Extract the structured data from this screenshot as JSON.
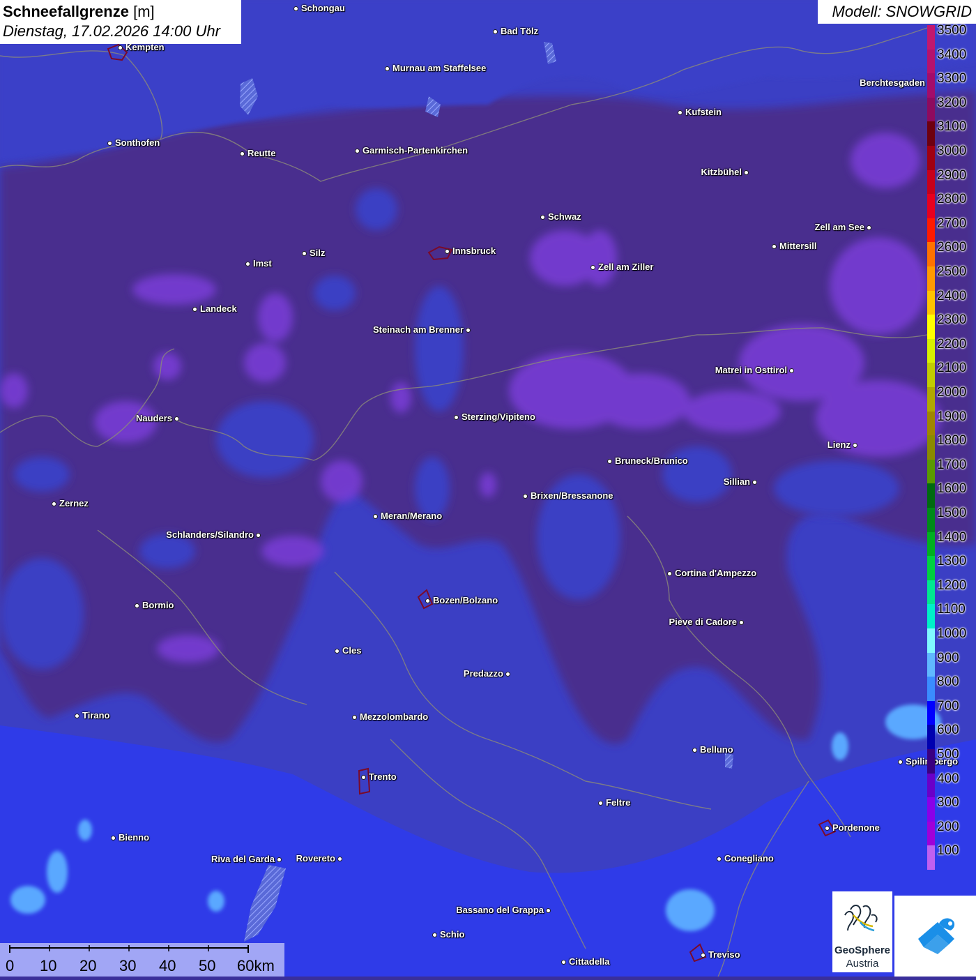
{
  "header": {
    "title_bold": "Schneefallgrenze",
    "title_unit": "[m]",
    "datetime": "Dienstag, 17.02.2026 14:00 Uhr",
    "model": "Modell: SNOWGRID"
  },
  "legend": {
    "levels": [
      {
        "label": "3500",
        "color": "#c2186e"
      },
      {
        "label": "3400",
        "color": "#b5126d"
      },
      {
        "label": "3300",
        "color": "#a30c6a"
      },
      {
        "label": "3200",
        "color": "#8e0a5f"
      },
      {
        "label": "3100",
        "color": "#6e0010"
      },
      {
        "label": "3000",
        "color": "#a00012"
      },
      {
        "label": "2900",
        "color": "#c8001a"
      },
      {
        "label": "2800",
        "color": "#e8001e"
      },
      {
        "label": "2700",
        "color": "#ff1a00"
      },
      {
        "label": "2600",
        "color": "#ff7200"
      },
      {
        "label": "2500",
        "color": "#ff9a00"
      },
      {
        "label": "2400",
        "color": "#ffc400"
      },
      {
        "label": "2300",
        "color": "#ffff00"
      },
      {
        "label": "2200",
        "color": "#d8f000"
      },
      {
        "label": "2100",
        "color": "#c2cc00"
      },
      {
        "label": "2000",
        "color": "#b0a800"
      },
      {
        "label": "1900",
        "color": "#a08600"
      },
      {
        "label": "1800",
        "color": "#8a8a00"
      },
      {
        "label": "1700",
        "color": "#5a9a00"
      },
      {
        "label": "1600",
        "color": "#006a10"
      },
      {
        "label": "1500",
        "color": "#008a18"
      },
      {
        "label": "1400",
        "color": "#00b020"
      },
      {
        "label": "1300",
        "color": "#00d040"
      },
      {
        "label": "1200",
        "color": "#00e890"
      },
      {
        "label": "1100",
        "color": "#00f0c8"
      },
      {
        "label": "1000",
        "color": "#80f8ff"
      },
      {
        "label": "900",
        "color": "#60b8ff"
      },
      {
        "label": "800",
        "color": "#3a8cff"
      },
      {
        "label": "700",
        "color": "#0000ff"
      },
      {
        "label": "600",
        "color": "#0000b0"
      },
      {
        "label": "500",
        "color": "#3a0080"
      },
      {
        "label": "400",
        "color": "#6a00c8"
      },
      {
        "label": "300",
        "color": "#8a00e8"
      },
      {
        "label": "200",
        "color": "#a000d8"
      },
      {
        "label": "100",
        "color": "#c060f0"
      }
    ]
  },
  "cities": [
    {
      "name": "Schongau",
      "side": "r"
    },
    {
      "name": "Bad Tölz",
      "side": "r"
    },
    {
      "name": "Kempten",
      "side": "r"
    },
    {
      "name": "Murnau am Staffelsee",
      "side": "r"
    },
    {
      "name": "Berchtesgaden",
      "side": "l"
    },
    {
      "name": "Kufstein",
      "side": "r"
    },
    {
      "name": "Sonthofen",
      "side": "r"
    },
    {
      "name": "Reutte",
      "side": "r"
    },
    {
      "name": "Garmisch-Partenkirchen",
      "side": "r"
    },
    {
      "name": "Kitzbühel",
      "side": "l"
    },
    {
      "name": "Schwaz",
      "side": "r"
    },
    {
      "name": "Zell am See",
      "side": "l"
    },
    {
      "name": "Mittersill",
      "side": "r"
    },
    {
      "name": "Innsbruck",
      "side": "r"
    },
    {
      "name": "Imst",
      "side": "r"
    },
    {
      "name": "Silz",
      "side": "r"
    },
    {
      "name": "Zell am Ziller",
      "side": "r"
    },
    {
      "name": "Landeck",
      "side": "r"
    },
    {
      "name": "Steinach am Brenner",
      "side": "l"
    },
    {
      "name": "Matrei in Osttirol",
      "side": "l"
    },
    {
      "name": "Nauders",
      "side": "l"
    },
    {
      "name": "Sterzing/Vipiteno",
      "side": "r"
    },
    {
      "name": "Lienz",
      "side": "l"
    },
    {
      "name": "Bruneck/Brunico",
      "side": "r"
    },
    {
      "name": "Sillian",
      "side": "l"
    },
    {
      "name": "Zernez",
      "side": "r"
    },
    {
      "name": "Brixen/Bressanone",
      "side": "r"
    },
    {
      "name": "Meran/Merano",
      "side": "r"
    },
    {
      "name": "Schlanders/Silandro",
      "side": "l"
    },
    {
      "name": "Cortina d'Ampezzo",
      "side": "r"
    },
    {
      "name": "Bozen/Bolzano",
      "side": "r"
    },
    {
      "name": "Bormio",
      "side": "r"
    },
    {
      "name": "Pieve di Cadore",
      "side": "l"
    },
    {
      "name": "Cles",
      "side": "r"
    },
    {
      "name": "Predazzo",
      "side": "l"
    },
    {
      "name": "Tirano",
      "side": "r"
    },
    {
      "name": "Mezzolombardo",
      "side": "r"
    },
    {
      "name": "Belluno",
      "side": "r"
    },
    {
      "name": "Spilimbergo",
      "side": "r"
    },
    {
      "name": "Trento",
      "side": "r"
    },
    {
      "name": "Feltre",
      "side": "r"
    },
    {
      "name": "Pordenone",
      "side": "r"
    },
    {
      "name": "Bienno",
      "side": "r"
    },
    {
      "name": "Riva del Garda",
      "side": "l"
    },
    {
      "name": "Rovereto",
      "side": "l"
    },
    {
      "name": "Conegliano",
      "side": "r"
    },
    {
      "name": "Bassano del Grappa",
      "side": "l"
    },
    {
      "name": "Schio",
      "side": "r"
    },
    {
      "name": "Treviso",
      "side": "r"
    },
    {
      "name": "Cittadella",
      "side": "r"
    }
  ],
  "scale": {
    "labels": [
      "0",
      "10",
      "20",
      "30",
      "40",
      "50",
      "60km"
    ]
  },
  "logo": {
    "name_line1": "GeoSphere",
    "name_line2": "Austria"
  }
}
